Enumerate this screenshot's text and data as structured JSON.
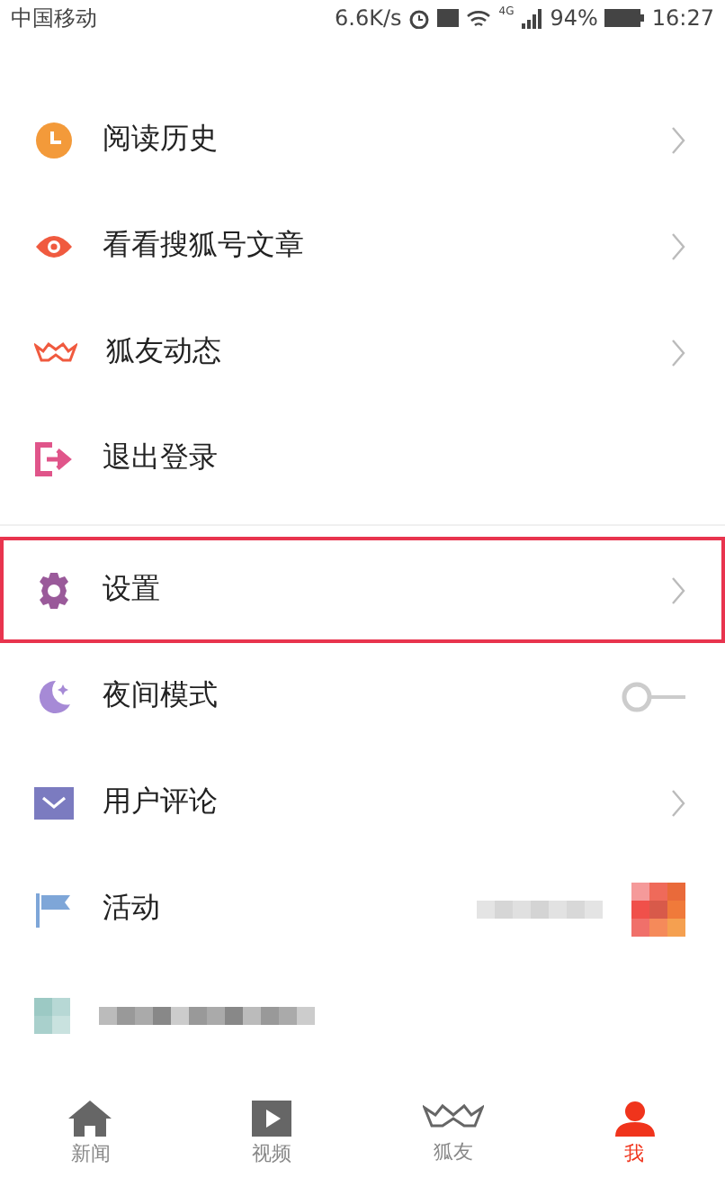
{
  "status_bar": {
    "carrier": "中国移动",
    "speed": "6.6K/s",
    "network": "4G",
    "battery": "94%",
    "time": "16:27"
  },
  "menu_groups": [
    [
      {
        "label": "阅读历史",
        "kind": "link",
        "highlighted": false
      },
      {
        "label": "看看搜狐号文章",
        "kind": "link",
        "highlighted": false
      },
      {
        "label": "狐友动态",
        "kind": "link",
        "highlighted": false
      },
      {
        "label": "退出登录",
        "kind": "plain",
        "highlighted": false
      }
    ],
    [
      {
        "label": "设置",
        "kind": "link",
        "highlighted": true
      },
      {
        "label": "夜间模式",
        "kind": "toggle",
        "on": false,
        "highlighted": false
      },
      {
        "label": "用户评论",
        "kind": "link",
        "highlighted": false
      },
      {
        "label": "活动",
        "kind": "promo",
        "highlighted": false
      },
      {
        "kind": "picture"
      }
    ]
  ],
  "tabs": [
    {
      "label": "新闻",
      "selected": false
    },
    {
      "label": "视频",
      "selected": false
    },
    {
      "label": "狐友",
      "selected": false
    },
    {
      "label": "我",
      "selected": true
    }
  ]
}
